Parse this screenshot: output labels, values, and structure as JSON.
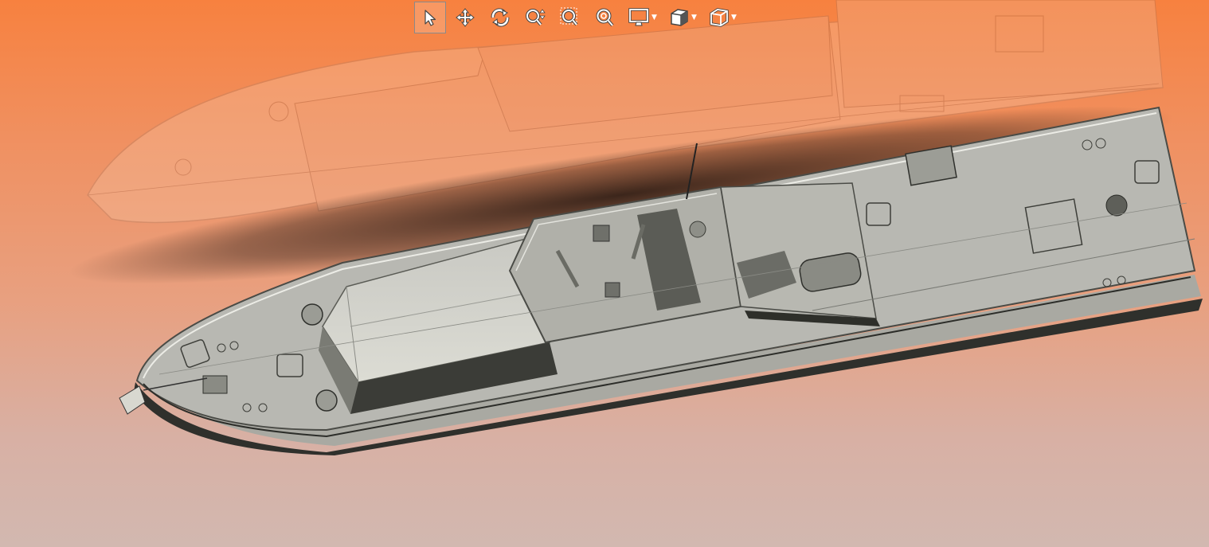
{
  "viewer": {
    "background_top": "#f7813f",
    "background_bottom": "#d2b8b0"
  },
  "toolbar": {
    "tools": [
      {
        "name": "select-tool",
        "icon": "cursor-arrow-icon",
        "active": true
      },
      {
        "name": "pan-tool",
        "icon": "move-arrows-icon",
        "active": false
      },
      {
        "name": "rotate-tool",
        "icon": "rotate-icon",
        "active": false
      },
      {
        "name": "zoom-tool",
        "icon": "zoom-updown-icon",
        "active": false
      },
      {
        "name": "zoom-window-tool",
        "icon": "zoom-window-icon",
        "active": false
      },
      {
        "name": "zoom-fit-tool",
        "icon": "zoom-fit-icon",
        "active": false
      },
      {
        "name": "display-mode-menu",
        "icon": "monitor-icon",
        "active": false
      },
      {
        "name": "render-mode-menu",
        "icon": "shaded-cube-icon",
        "active": false
      },
      {
        "name": "view-orientation-menu",
        "icon": "wire-cube-icon",
        "active": false
      }
    ]
  },
  "model": {
    "hull_color": "#a9a9a2",
    "deck_color": "#b8b8b2",
    "dark_color": "#2f302c"
  }
}
